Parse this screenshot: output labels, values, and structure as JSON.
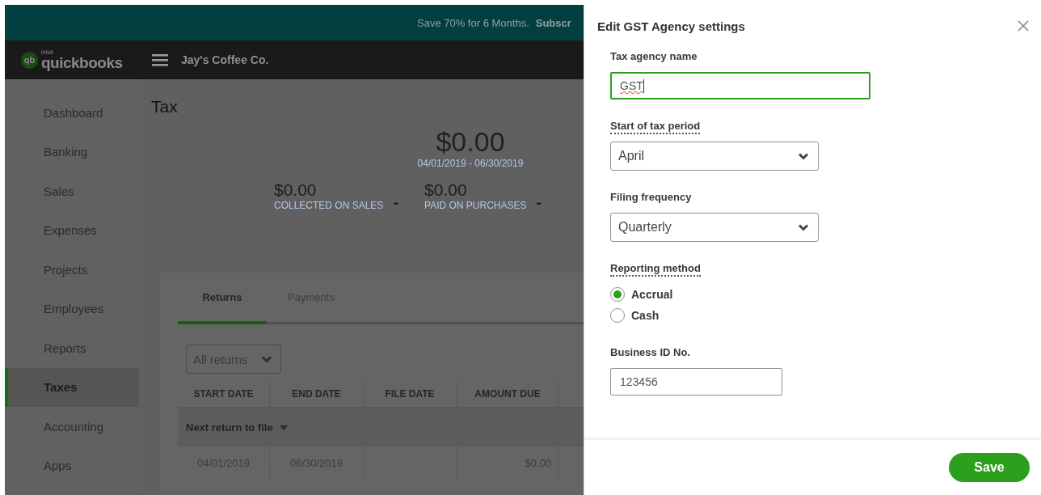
{
  "banner": {
    "text": "Save 70% for 6 Months.",
    "link": "Subscr"
  },
  "nav": {
    "logo_mark": "qb",
    "logo_small": "intuit",
    "logo_name": "quickbooks",
    "company": "Jay's Coffee Co."
  },
  "sidebar": {
    "items": [
      {
        "label": "Dashboard",
        "selected": false
      },
      {
        "label": "Banking",
        "selected": false
      },
      {
        "label": "Sales",
        "selected": false
      },
      {
        "label": "Expenses",
        "selected": false
      },
      {
        "label": "Projects",
        "selected": false
      },
      {
        "label": "Employees",
        "selected": false
      },
      {
        "label": "Reports",
        "selected": false
      },
      {
        "label": "Taxes",
        "selected": true
      },
      {
        "label": "Accounting",
        "selected": false
      },
      {
        "label": "Apps",
        "selected": false
      }
    ]
  },
  "page": {
    "title": "Tax",
    "total": {
      "amount": "$0.00",
      "period": "04/01/2019 - 06/30/2019"
    },
    "summary": [
      {
        "amount": "$0.00",
        "label": "COLLECTED ON SALES",
        "operator": "-"
      },
      {
        "amount": "$0.00",
        "label": "PAID ON PURCHASES",
        "operator": "-"
      }
    ],
    "tabs": [
      {
        "label": "Returns",
        "selected": true
      },
      {
        "label": "Payments",
        "selected": false
      }
    ],
    "filter": "All returns",
    "table": {
      "columns": [
        "START DATE",
        "END DATE",
        "FILE DATE",
        "AMOUNT DUE"
      ],
      "group": "Next return to file",
      "rows": [
        {
          "start_date": "04/01/2019",
          "end_date": "06/30/2019",
          "amount_due": "$0.00"
        }
      ]
    }
  },
  "panel": {
    "title": "Edit GST Agency settings",
    "fields": [
      {
        "kind": "text",
        "label": "Tax agency name",
        "value": "GST",
        "focused": true,
        "help_tip": false,
        "misspelled": true
      },
      {
        "kind": "select",
        "label": "Start of tax period",
        "value": "April",
        "help_tip": true
      },
      {
        "kind": "select",
        "label": "Filing frequency",
        "value": "Quarterly",
        "help_tip": false
      },
      {
        "kind": "radio",
        "label": "Reporting method",
        "help_tip": true,
        "options": [
          {
            "label": "Accrual",
            "selected": true
          },
          {
            "label": "Cash",
            "selected": false
          }
        ]
      },
      {
        "kind": "text",
        "label": "Business ID No.",
        "value": "123456",
        "focused": false,
        "help_tip": false,
        "misspelled": false
      }
    ],
    "save": "Save"
  }
}
